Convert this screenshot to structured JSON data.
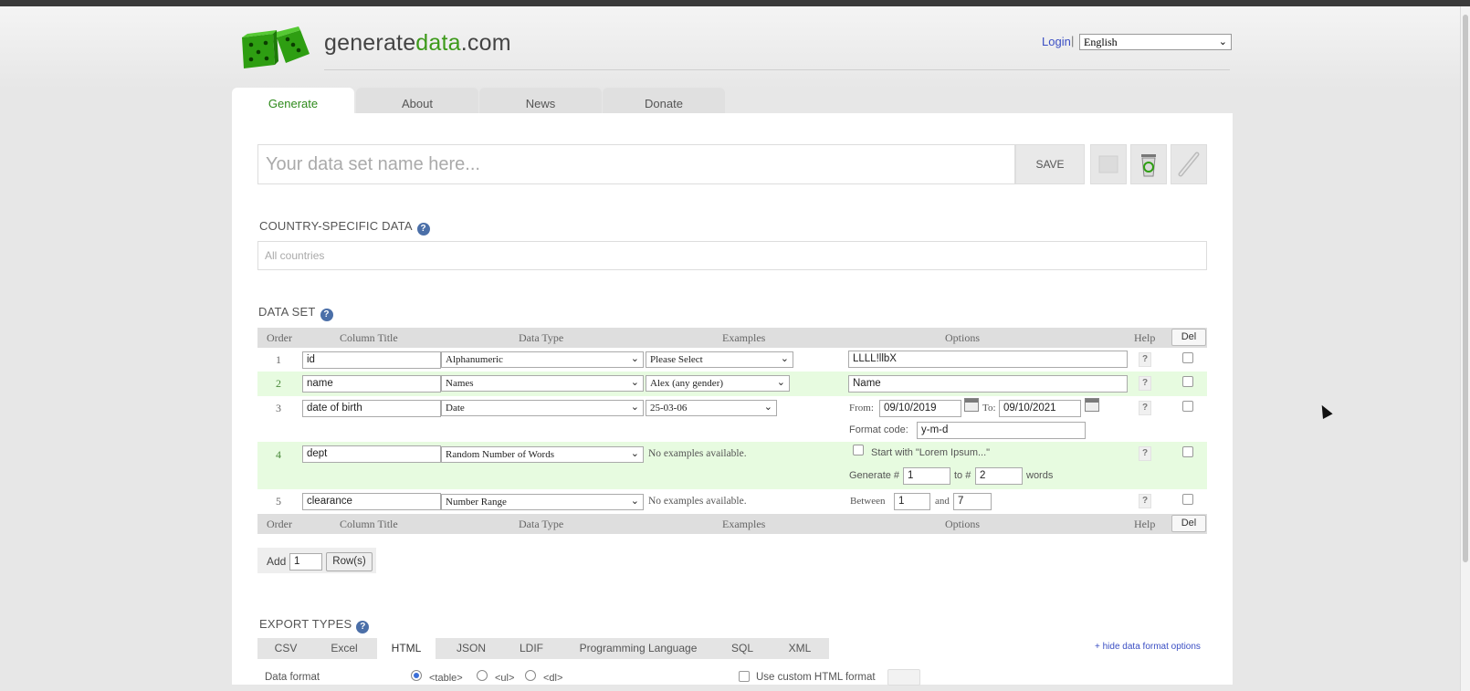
{
  "header": {
    "logo_main": "generate",
    "logo_accent": "data",
    "logo_suffix": ".com",
    "login": "Login",
    "separator": "|",
    "language": "English"
  },
  "tabs": [
    "Generate",
    "About",
    "News",
    "Donate"
  ],
  "toolbar": {
    "dataset_placeholder": "Your data set name here...",
    "save_label": "SAVE"
  },
  "country": {
    "title": "COUNTRY-SPECIFIC DATA",
    "placeholder": "All countries"
  },
  "dataset": {
    "title": "DATA SET",
    "headers": {
      "order": "Order",
      "column_title": "Column Title",
      "data_type": "Data Type",
      "examples": "Examples",
      "options": "Options",
      "help": "Help",
      "del": "Del"
    },
    "rows": [
      {
        "order": "1",
        "title": "id",
        "type": "Alphanumeric",
        "example": "Please Select",
        "option": "LLLL!llbX"
      },
      {
        "order": "2",
        "title": "name",
        "type": "Names",
        "example": "Alex (any gender)",
        "option": "Name"
      },
      {
        "order": "3",
        "title": "date of birth",
        "type": "Date",
        "example": "25-03-06",
        "from_label": "From:",
        "from": "09/10/2019",
        "to_label": "To:",
        "to": "09/10/2021",
        "format_label": "Format code:",
        "format": "y-m-d"
      },
      {
        "order": "4",
        "title": "dept",
        "type": "Random Number of Words",
        "example": "No examples available.",
        "lorem_label": "Start with \"Lorem Ipsum...\"",
        "gen_label": "Generate #",
        "gen_from": "1",
        "gen_to_label": "to #",
        "gen_to": "2",
        "gen_suffix": "words"
      },
      {
        "order": "5",
        "title": "clearance",
        "type": "Number Range",
        "example": "No examples available.",
        "between_label": "Between",
        "between_from": "1",
        "and_label": "and",
        "between_to": "7"
      }
    ],
    "help_symbol": "?",
    "add_label": "Add",
    "add_value": "1",
    "rows_button": "Row(s)"
  },
  "export": {
    "title": "EXPORT TYPES",
    "tabs": [
      "CSV",
      "Excel",
      "HTML",
      "JSON",
      "LDIF",
      "Programming Language",
      "SQL",
      "XML"
    ],
    "active_tab": "HTML",
    "hide_link": "+ hide data format options",
    "format_label": "Data format",
    "formats": [
      "<table>",
      "<ul>",
      "<dl>"
    ],
    "custom_label": "Use custom HTML format"
  }
}
